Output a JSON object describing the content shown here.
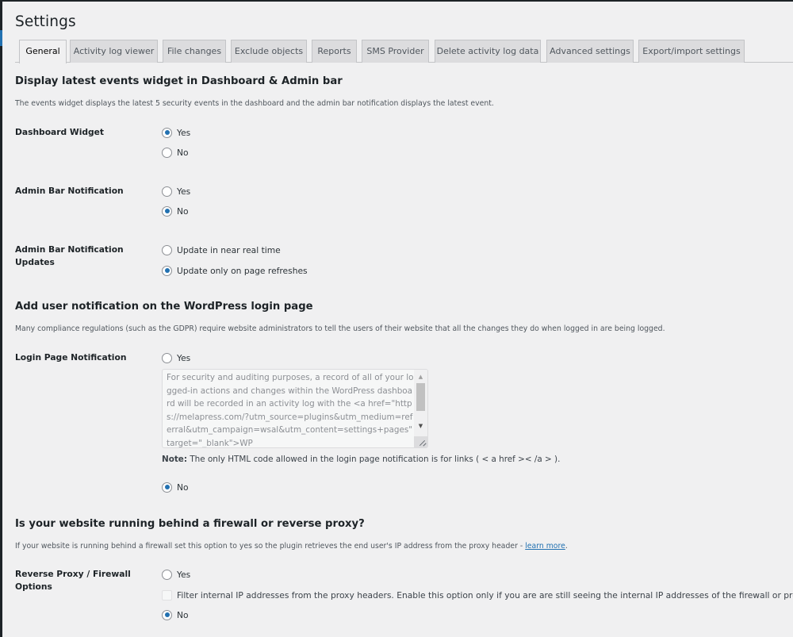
{
  "page": {
    "title": "Settings"
  },
  "tabs": [
    {
      "label": "General",
      "active": true
    },
    {
      "label": "Activity log viewer",
      "active": false
    },
    {
      "label": "File changes",
      "active": false
    },
    {
      "label": "Exclude objects",
      "active": false
    },
    {
      "label": "Reports",
      "active": false
    },
    {
      "label": "SMS Provider",
      "active": false
    },
    {
      "label": "Delete activity log data",
      "active": false
    },
    {
      "label": "Advanced settings",
      "active": false
    },
    {
      "label": "Export/import settings",
      "active": false
    }
  ],
  "sections": {
    "widget": {
      "title": "Display latest events widget in Dashboard & Admin bar",
      "description": "The events widget displays the latest 5 security events in the dashboard and the admin bar notification displays the latest event.",
      "dashboard_widget": {
        "label": "Dashboard Widget",
        "options": [
          {
            "label": "Yes",
            "checked": true
          },
          {
            "label": "No",
            "checked": false
          }
        ]
      },
      "admin_bar_notification": {
        "label": "Admin Bar Notification",
        "options": [
          {
            "label": "Yes",
            "checked": false
          },
          {
            "label": "No",
            "checked": true
          }
        ]
      },
      "admin_bar_updates": {
        "label_line1": "Admin Bar Notification",
        "label_line2": "Updates",
        "options": [
          {
            "label": "Update in near real time",
            "checked": false
          },
          {
            "label": "Update only on page refreshes",
            "checked": true
          }
        ]
      }
    },
    "login": {
      "title": "Add user notification on the WordPress login page",
      "description": "Many compliance regulations (such as the GDPR) require website administrators to tell the users of their website that all the changes they do when logged in are being logged.",
      "login_notification": {
        "label": "Login Page Notification",
        "yes_label": "Yes",
        "yes_checked": false,
        "textarea_value": "For security and auditing purposes, a record of all of your logged-in actions and changes within the WordPress dashboard will be recorded in an activity log with the <a href=\"https://melapress.com/?utm_source=plugins&utm_medium=referral&utm_campaign=wsal&utm_content=settings+pages\" target=\"_blank\">WP",
        "note_bold": "Note:",
        "note_text": " The only HTML code allowed in the login page notification is for links ( < a href >< /a > ).",
        "no_label": "No",
        "no_checked": true
      }
    },
    "proxy": {
      "title": "Is your website running behind a firewall or reverse proxy?",
      "description": "If your website is running behind a firewall set this option to yes so the plugin retrieves the end user's IP address from the proxy header - ",
      "learn_more": "learn more",
      "description_end": ".",
      "reverse_proxy": {
        "label_line1": "Reverse Proxy / Firewall",
        "label_line2": "Options",
        "yes_label": "Yes",
        "yes_checked": false,
        "filter_label": "Filter internal IP addresses from the proxy headers. Enable this option only if you are are still seeing the internal IP addresses of the firewall or proxy.",
        "filter_checked": false,
        "no_label": "No",
        "no_checked": true
      }
    }
  },
  "colors": {
    "accent": "#2271b1",
    "background": "#f0f0f1",
    "tab_inactive": "#dcdcde"
  }
}
